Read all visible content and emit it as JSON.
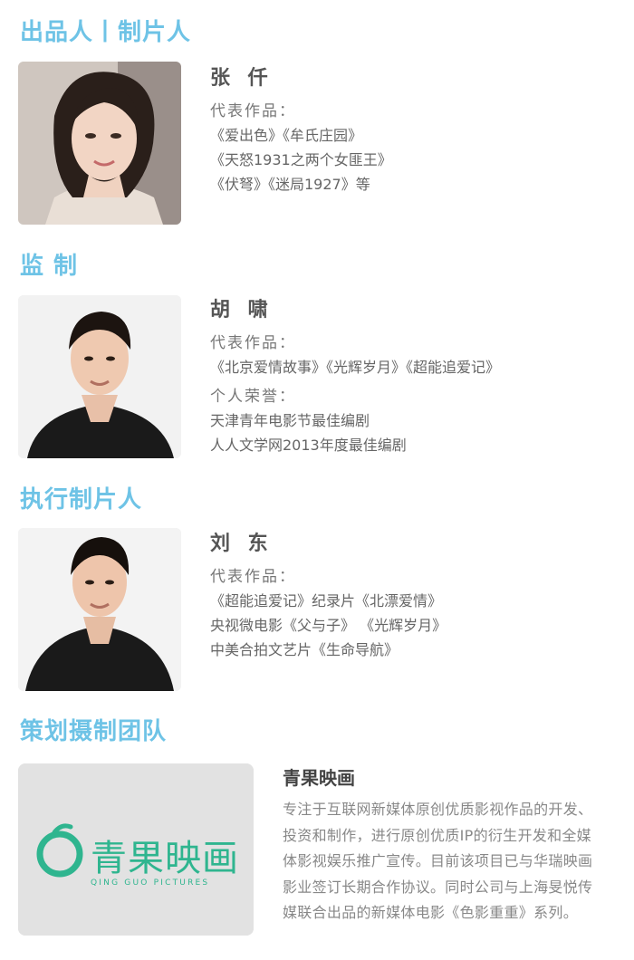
{
  "sections": {
    "producer": {
      "heading": "出品人丨制片人",
      "name": "张 仟",
      "works_label": "代表作品：",
      "works": [
        "《爱出色》《牟氏庄园》",
        "《天怒1931之两个女匪王》",
        "《伏弩》《迷局1927》等"
      ]
    },
    "supervisor": {
      "heading": "监 制",
      "name": "胡 啸",
      "works_label": "代表作品：",
      "works": [
        "《北京爱情故事》《光辉岁月》《超能追爱记》"
      ],
      "honors_label": "个人荣誉：",
      "honors": [
        "天津青年电影节最佳编剧",
        "人人文学网2013年度最佳编剧"
      ]
    },
    "executive": {
      "heading": "执行制片人",
      "name": "刘 东",
      "works_label": "代表作品：",
      "works": [
        "《超能追爱记》纪录片《北漂爱情》",
        "央视微电影《父与子》 《光辉岁月》",
        "中美合拍文艺片《生命导航》"
      ]
    },
    "team": {
      "heading": "策划摄制团队",
      "company_name": "青果映画",
      "logo_text": "青果映画",
      "logo_subtext": "QING GUO PICTURES",
      "description": "专注于互联网新媒体原创优质影视作品的开发、投资和制作，进行原创优质IP的衍生开发和全媒体影视娱乐推广宣传。目前该项目已与华瑞映画影业签订长期合作协议。同时公司与上海旻悦传媒联合出品的新媒体电影《色影重重》系列。"
    }
  },
  "colors": {
    "heading": "#6ec3e6",
    "logo_green": "#2fb58f",
    "logo_bg": "#e2e2e2"
  }
}
